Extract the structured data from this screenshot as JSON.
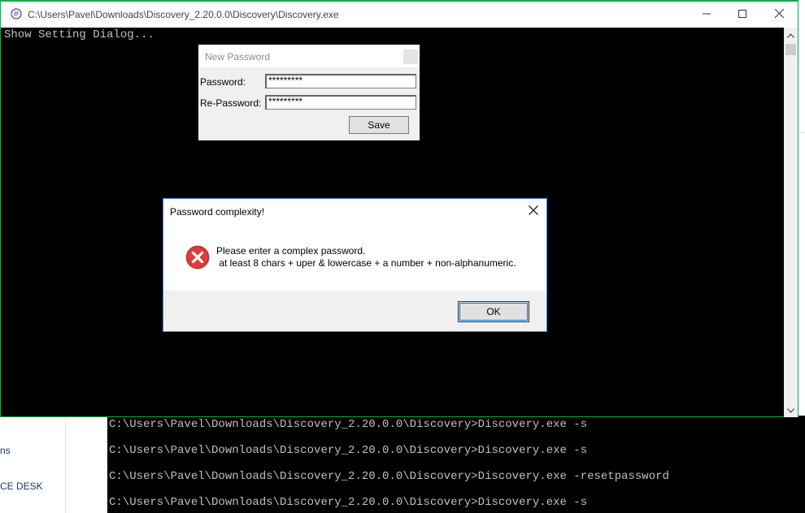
{
  "background": {
    "left_fragments": [
      "ns",
      "CE DESK"
    ],
    "console_lines": [
      "C:\\Users\\Pavel\\Downloads\\Discovery_2.20.0.0\\Discovery>Discovery.exe -s",
      "C:\\Users\\Pavel\\Downloads\\Discovery_2.20.0.0\\Discovery>Discovery.exe -s",
      "C:\\Users\\Pavel\\Downloads\\Discovery_2.20.0.0\\Discovery>Discovery.exe -resetpassword",
      "C:\\Users\\Pavel\\Downloads\\Discovery_2.20.0.0\\Discovery>Discovery.exe -s"
    ]
  },
  "console": {
    "title": "C:\\Users\\Pavel\\Downloads\\Discovery_2.20.0.0\\Discovery\\Discovery.exe",
    "output": "Show Setting Dialog...",
    "accent_color": "#18a94d"
  },
  "new_password_dialog": {
    "title": "New Password",
    "password_label": "Password:",
    "password_value": "*********",
    "repassword_label": "Re-Password:",
    "repassword_value": "*********",
    "save_label": "Save"
  },
  "message_box": {
    "title": "Password complexity!",
    "line1": "Please enter a complex password.",
    "line2": " at least 8 chars + uper & lowercase + a number + non-alphanumeric.",
    "ok_label": "OK",
    "icon": "error-icon"
  }
}
